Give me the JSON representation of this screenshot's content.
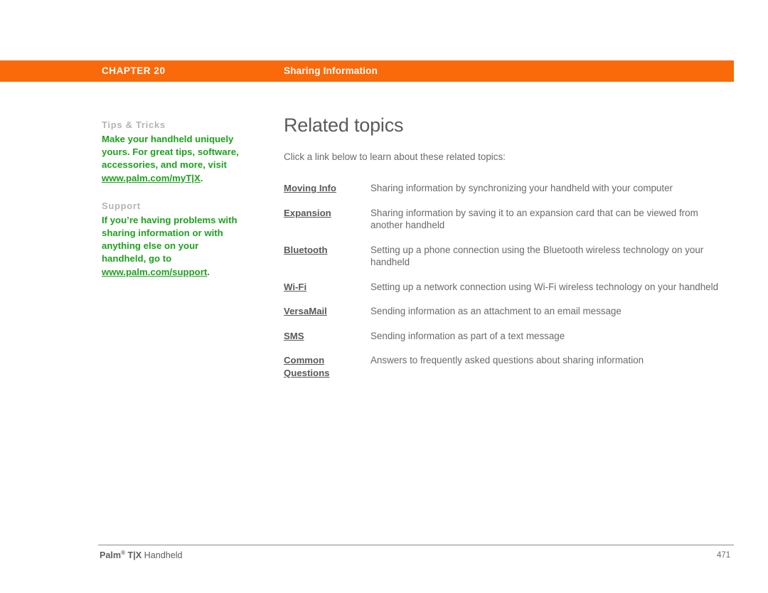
{
  "colors": {
    "header_band": "#FA6A0A",
    "header_text": "#FFFFFF",
    "sidebar_heading": "#B4B4B4",
    "sidebar_body": "#1FA01F",
    "title": "#5B5B5B",
    "body": "#6A6A6A",
    "topic_link": "#595959",
    "footer_rule": "#8A8A8A"
  },
  "header": {
    "chapter": "CHAPTER 20",
    "section": "Sharing Information"
  },
  "sidebar": {
    "blocks": [
      {
        "heading": "Tips & Tricks",
        "body_before": "Make your handheld uniquely yours. For great tips, software, accessories, and more, visit ",
        "link": "www.palm.com/myT|X",
        "body_after": "."
      },
      {
        "heading": "Support",
        "body_before": "If you’re having problems with sharing information or with anything else on your handheld, go to ",
        "link": "www.palm.com/support",
        "body_after": "."
      }
    ]
  },
  "main": {
    "title": "Related topics",
    "intro": "Click a link below to learn about these related topics:",
    "topics": [
      {
        "link": "Moving Info",
        "description": "Sharing information by synchronizing your handheld with your computer"
      },
      {
        "link": "Expansion",
        "description": "Sharing information by saving it to an expansion card that can be viewed from another handheld"
      },
      {
        "link": "Bluetooth",
        "description": "Setting up a phone connection using the Bluetooth wireless technology on your handheld"
      },
      {
        "link": "Wi-Fi",
        "description": "Setting up a network connection using Wi-Fi wireless technology on your handheld"
      },
      {
        "link": "VersaMail",
        "description": "Sending information as an attachment to an email message"
      },
      {
        "link": "SMS",
        "description": "Sending information as part of a text message"
      },
      {
        "link": "Common Questions",
        "description": "Answers to frequently asked questions about sharing information"
      }
    ]
  },
  "footer": {
    "brand": "Palm",
    "registered_mark": "®",
    "product": " T|X",
    "product_suffix": " Handheld",
    "page_number": "471"
  }
}
